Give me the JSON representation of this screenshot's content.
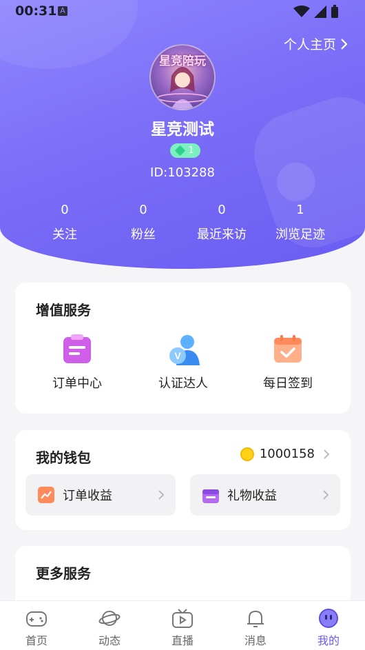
{
  "status": {
    "time": "00:31",
    "a_icon": "A"
  },
  "header": {
    "profile_link": "个人主页"
  },
  "user": {
    "avatar_text": "星竞陪玩",
    "name": "星竞测试",
    "level": "1",
    "id": "ID:103288"
  },
  "stats": [
    {
      "num": "0",
      "label": "关注"
    },
    {
      "num": "0",
      "label": "粉丝"
    },
    {
      "num": "0",
      "label": "最近来访"
    },
    {
      "num": "1",
      "label": "浏览足迹"
    }
  ],
  "services": {
    "title": "增值服务",
    "items": [
      {
        "label": "订单中心",
        "icon": "clipboard-icon"
      },
      {
        "label": "认证达人",
        "icon": "verified-user-icon"
      },
      {
        "label": "每日签到",
        "icon": "calendar-check-icon"
      }
    ]
  },
  "wallet": {
    "title": "我的钱包",
    "balance": "1000158",
    "order_income": "订单收益",
    "gift_income": "礼物收益"
  },
  "more": {
    "title": "更多服务"
  },
  "tabs": [
    {
      "label": "首页",
      "icon": "gamepad-icon"
    },
    {
      "label": "动态",
      "icon": "planet-icon"
    },
    {
      "label": "直播",
      "icon": "tv-icon"
    },
    {
      "label": "消息",
      "icon": "bell-icon"
    },
    {
      "label": "我的",
      "icon": "face-icon"
    }
  ],
  "colors": {
    "accent": "#6a5cf2",
    "hero_start": "#8f86ff",
    "coin": "#ffd21a"
  }
}
